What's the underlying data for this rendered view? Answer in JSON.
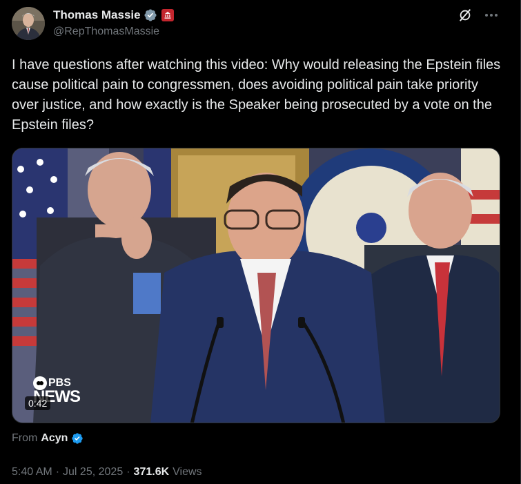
{
  "author": {
    "display_name": "Thomas Massie",
    "handle": "@RepThomasMassie"
  },
  "icons": {
    "verified": "verified-badge-icon",
    "government": "government-affiliation-icon",
    "grok": "grok-icon",
    "more": "more-options-icon"
  },
  "post": {
    "text": "I have questions after watching this video: Why would releasing the Epstein files cause political pain to congressmen, does avoiding political pain take priority over justice, and how exactly is the Speaker being prosecuted by a vote on the Epstein files?"
  },
  "media": {
    "watermark_brand": "PBS",
    "watermark_sub": "NEWS",
    "duration": "0:42"
  },
  "attribution": {
    "prefix": "From",
    "name": "Acyn"
  },
  "meta": {
    "time": "5:40 AM",
    "separator": "·",
    "date": "Jul 25, 2025",
    "views_count": "371.6K",
    "views_label": "Views"
  },
  "colors": {
    "background": "#000000",
    "text_primary": "#e7e9ea",
    "text_secondary": "#71767b",
    "verified_gray": "#829aab",
    "verified_blue": "#1d9bf0",
    "gov_red": "#c4262e"
  }
}
